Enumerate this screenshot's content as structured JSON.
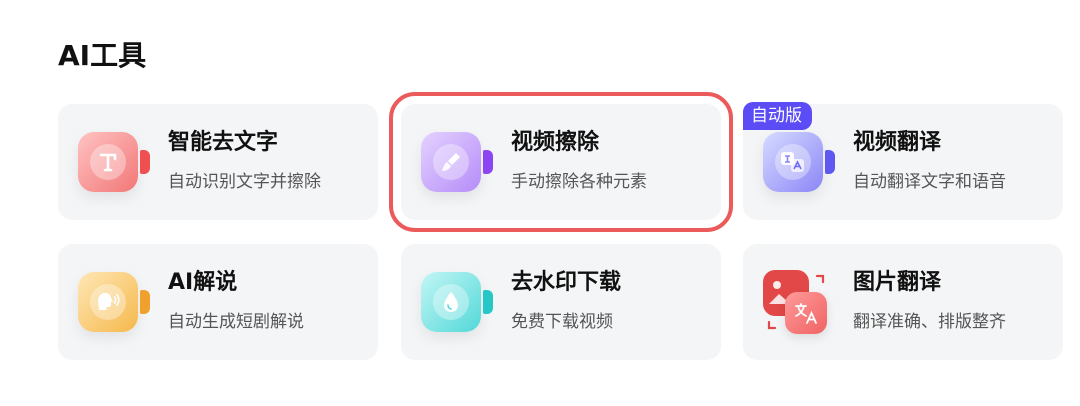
{
  "section": {
    "title": "AI工具"
  },
  "colors": {
    "card_bg": "#f4f5f7",
    "highlight_border": "#ec5b5b",
    "badge_bg": "#5b4cf5"
  },
  "tools": [
    {
      "title": "智能去文字",
      "description": "自动识别文字并擦除",
      "icon": "text-erase-icon",
      "color": "#f06a6a"
    },
    {
      "title": "视频擦除",
      "description": "手动擦除各种元素",
      "icon": "brush-icon",
      "color": "#a774f7",
      "highlighted": true
    },
    {
      "title": "视频翻译",
      "description": "自动翻译文字和语音",
      "icon": "translate-icon",
      "color": "#6f6cf6",
      "badge": "自动版"
    },
    {
      "title": "AI解说",
      "description": "自动生成短剧解说",
      "icon": "speaking-head-icon",
      "color": "#f4b244"
    },
    {
      "title": "去水印下载",
      "description": "免费下载视频",
      "icon": "water-drop-icon",
      "color": "#3fd3d3"
    },
    {
      "title": "图片翻译",
      "description": "翻译准确、排版整齐",
      "icon": "image-translate-icon",
      "color": "#e24848"
    }
  ]
}
